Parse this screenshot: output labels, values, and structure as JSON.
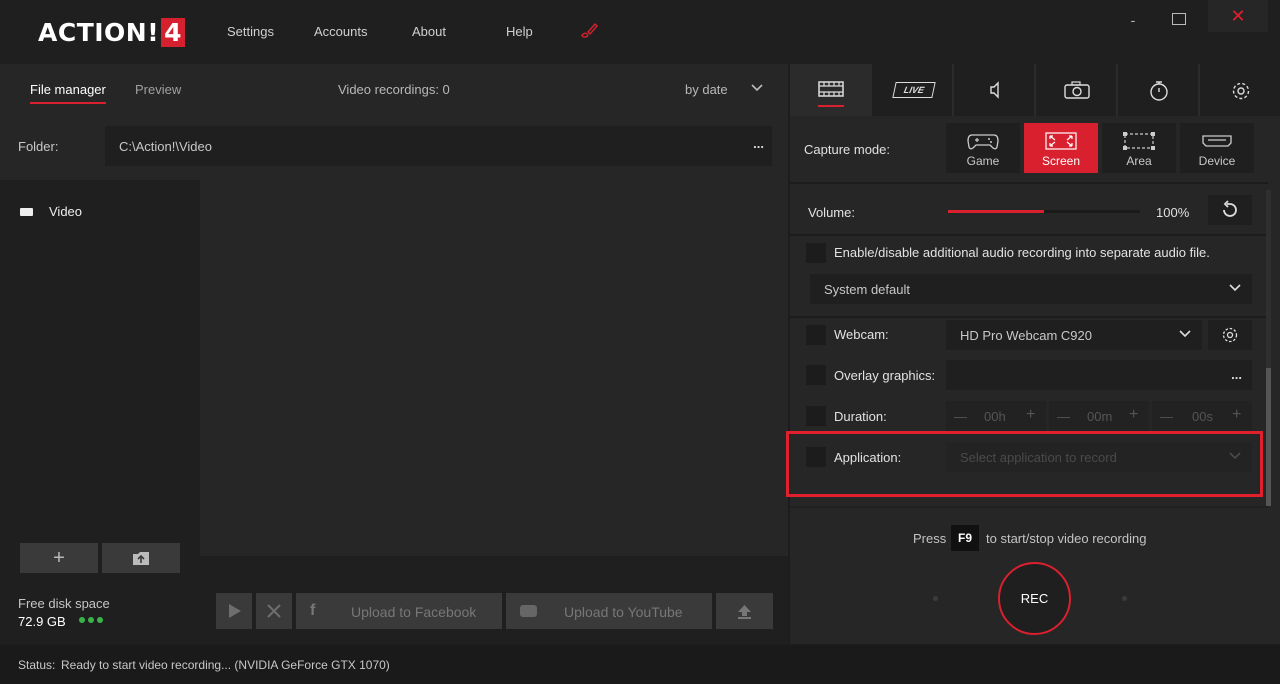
{
  "app": {
    "logo_text": "ACTION!",
    "logo_version": "4"
  },
  "menu": {
    "settings": "Settings",
    "accounts": "Accounts",
    "about": "About",
    "help": "Help"
  },
  "window": {
    "minimize": "-",
    "close": "✕"
  },
  "left": {
    "tab_file_manager": "File manager",
    "tab_preview": "Preview",
    "recordings_count": "Video recordings: 0",
    "sort": "by date",
    "folder_label": "Folder:",
    "folder_path": "C:\\Action!\\Video",
    "folder_more": "...",
    "tree": [
      {
        "label": "Video"
      }
    ],
    "add_label": "+",
    "disk_label": "Free disk space",
    "disk_value": "72.9 GB",
    "upload_facebook": "Upload to Facebook",
    "upload_youtube": "Upload to YouTube"
  },
  "right": {
    "tabs": [
      "video-recording-icon",
      "live-streaming-icon",
      "audio-icon",
      "screenshot-icon",
      "timer-icon",
      "settings-gear-icon"
    ],
    "live_badge": "LIVE",
    "capture_mode_label": "Capture mode:",
    "modes": [
      {
        "label": "Game",
        "icon": "gamepad-icon"
      },
      {
        "label": "Screen",
        "icon": "screen-icon"
      },
      {
        "label": "Area",
        "icon": "area-icon"
      },
      {
        "label": "Device",
        "icon": "device-icon"
      }
    ],
    "active_mode": "Screen",
    "volume_label": "Volume:",
    "volume_value": 1.0,
    "volume_text": "100%",
    "separate_audio_label": "Enable/disable additional audio recording into separate audio file.",
    "audio_device": "System default",
    "webcam_label": "Webcam:",
    "webcam_device": "HD Pro Webcam C920",
    "overlay_label": "Overlay graphics:",
    "overlay_more": "...",
    "duration_label": "Duration:",
    "duration": {
      "hours": "00h",
      "minutes": "00m",
      "seconds": "00s"
    },
    "application_label": "Application:",
    "application_placeholder": "Select application to record",
    "press_text": "Press",
    "press_key": "F9",
    "press_text2": "to start/stop video recording",
    "rec_label": "REC"
  },
  "status": {
    "label": "Status:",
    "text": "Ready to start video recording... (NVIDIA GeForce GTX 1070)"
  },
  "colors": {
    "accent": "#d9202e",
    "disk_ok": "#39b34a"
  }
}
